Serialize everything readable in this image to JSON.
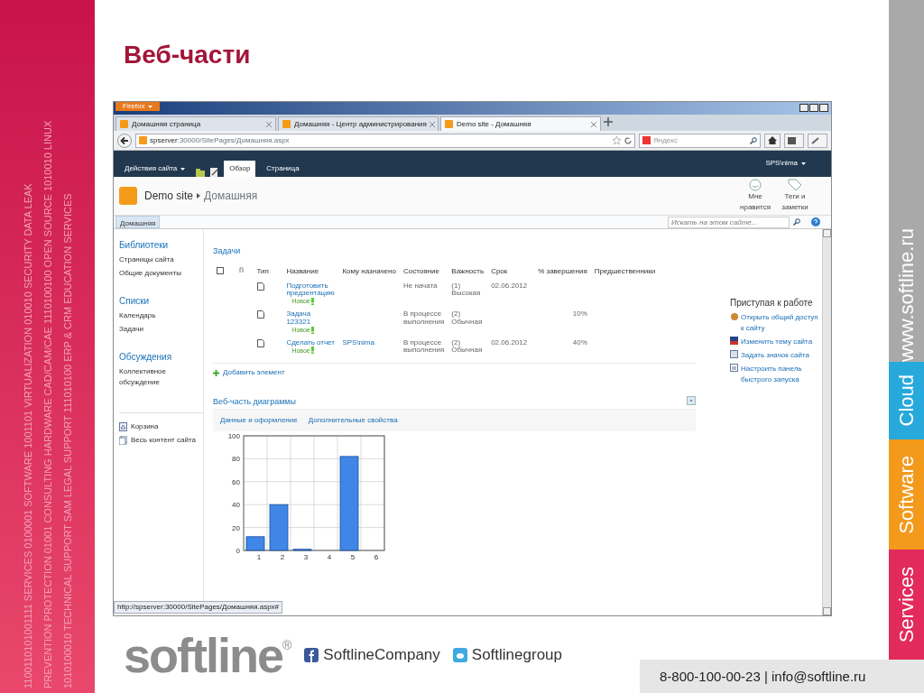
{
  "banner": {
    "lines": [
      "1100110101001111 SERVICES 0100001 SOFTWARE 1001101 VIRTUALIZATION 010010 SECURITY DATA LEAK",
      "PREVENTION PROTECTION 01001 CONSULTING HARDWARE CAD/CAM/CAE 1110100100 OPEN SOURCE 1010010 LINUX",
      "1010100010 TECHNICAL SUPPORT SAM LEGAL SUPPORT 111010100 ERP & CRM EDUCATION SERVICES"
    ]
  },
  "slide": {
    "title": "Веб-части"
  },
  "browser": {
    "menu_button": "Firefox",
    "tabs": [
      {
        "label": "Домашняя страница",
        "selected": false
      },
      {
        "label": "Домашняя - Центр администрирования",
        "selected": false
      },
      {
        "label": "Demo site - Домашняя",
        "selected": true
      }
    ],
    "url": {
      "host": "spserver",
      "path": ":30000/SitePages/Домашняя.aspx"
    },
    "search": {
      "placeholder": "Яндекс"
    },
    "status_bar": "http://spserver:30000/SitePages/Домашняя.aspx#"
  },
  "sharepoint": {
    "site_actions": "Действия сайта",
    "ribbon_tabs": [
      {
        "label": "Обзор",
        "selected": true
      },
      {
        "label": "Страница",
        "selected": false
      }
    ],
    "user": "SPS\\nima",
    "site": "Demo site",
    "page": "Домашняя",
    "header_actions": [
      "Мне нравится",
      "Теги и заметки"
    ],
    "top_nav": [
      {
        "label": "Домашняя",
        "selected": true
      }
    ],
    "site_search": {
      "placeholder": "Искать на этом сайте..."
    },
    "quick_launch": [
      {
        "heading": "Библиотеки",
        "items": [
          "Страницы сайта",
          "Общие документы"
        ]
      },
      {
        "heading": "Списки",
        "items": [
          "Календарь",
          "Задачи"
        ]
      },
      {
        "heading": "Обсуждения",
        "items": [
          "Коллективное обсуждение"
        ]
      }
    ],
    "quick_launch_footer": [
      "Корзина",
      "Весь контент сайта"
    ],
    "tasks": {
      "title": "Задачи",
      "select_all": {
        "checked": false
      },
      "columns": [
        "Тип",
        "Название",
        "Кому назначено",
        "Состояние",
        "Важность",
        "Срок",
        "% завершения",
        "Предшественники"
      ],
      "rows": [
        {
          "title": "Подготовить предзентацию",
          "new": "Новое",
          "status": "Не начата",
          "priority": "(1) Высокая",
          "due": "02.06.2012"
        },
        {
          "title": "Задача 123321",
          "new": "Новое",
          "status": "В процессе выполнения",
          "priority": "(2) Обычная",
          "percent": "10%"
        },
        {
          "title": "Сделать отчет",
          "new": "Новое",
          "assigned": "SPS\\nima",
          "status": "В процессе выполнения",
          "priority": "(2) Обычная",
          "due": "02.06.2012",
          "percent": "40%"
        }
      ],
      "add_item": "Добавить элемент"
    },
    "chart_part": {
      "title": "Веб-часть диаграммы",
      "links": [
        "Данные и оформление",
        "Дополнительные свойства"
      ],
      "chart_data": {
        "type": "bar",
        "categories": [
          "1",
          "2",
          "3",
          "4",
          "5",
          "6"
        ],
        "series": [
          {
            "color": "#3f86e6",
            "values": [
              12,
              40,
              1,
              0,
              82,
              null
            ]
          }
        ],
        "ylim": [
          0,
          100
        ],
        "yticks": [
          0,
          20,
          40,
          60,
          80,
          100
        ],
        "grid": true
      }
    },
    "getting_started": {
      "title": "Приступая к работе",
      "items": [
        "Открыть общий доступ к сайту",
        "Изменить тему сайта",
        "Задать значок сайта",
        "Настроить панель быстрого запуска"
      ]
    }
  },
  "footer": {
    "brand": "softline",
    "registered": "®",
    "social": [
      "SoftlineCompany",
      "Softlinegroup"
    ],
    "contact": "8-800-100-00-23 | info@softline.ru"
  },
  "right_strip": {
    "site": "www.softline.ru",
    "sections": [
      {
        "label": "Cloud",
        "color": "#28a9dc"
      },
      {
        "label": "Software",
        "color": "#f39a1c"
      },
      {
        "label": "Services",
        "color": "#e22a5c"
      }
    ]
  }
}
